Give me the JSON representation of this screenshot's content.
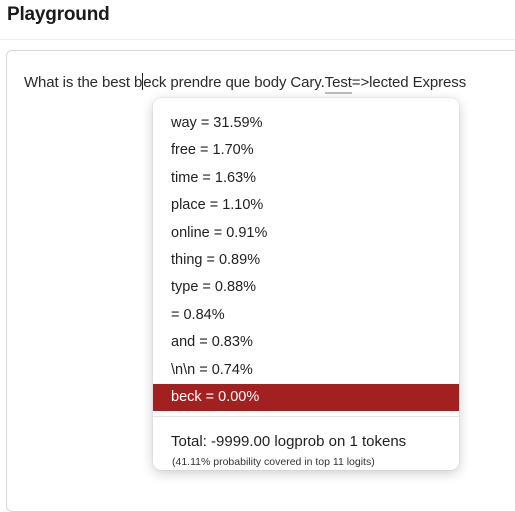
{
  "header": {
    "title": "Playground"
  },
  "prompt": {
    "before_caret": "What is the best b",
    "after_caret": "eck prendre que body Cary.",
    "selected_token": "Test",
    "after_selected": "=>lected Express"
  },
  "logprobs": {
    "items": [
      {
        "label": "way = 31.59%"
      },
      {
        "label": "free = 1.70%"
      },
      {
        "label": "time = 1.63%"
      },
      {
        "label": "place = 1.10%"
      },
      {
        "label": "online = 0.91%"
      },
      {
        "label": "thing = 0.89%"
      },
      {
        "label": "type = 0.88%"
      },
      {
        "label": " = 0.84%"
      },
      {
        "label": "and = 0.83%"
      },
      {
        "label": "\\n\\n = 0.74%"
      },
      {
        "label": "beck = 0.00%"
      }
    ],
    "selected_index": 10,
    "selected_color": "#a32020",
    "total": "Total: -9999.00 logprob on 1 tokens",
    "coverage": "(41.11% probability covered in top 11 logits)"
  }
}
